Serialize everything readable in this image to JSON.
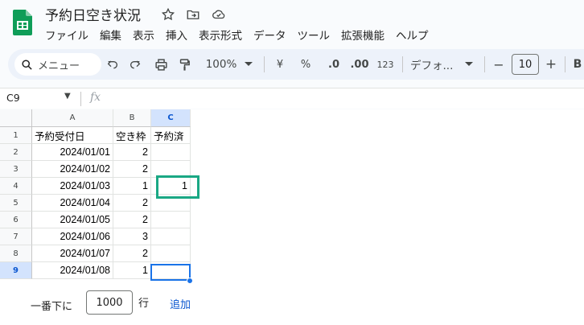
{
  "app": {
    "title": "予約日空き状況",
    "menu": [
      "ファイル",
      "編集",
      "表示",
      "挿入",
      "表示形式",
      "データ",
      "ツール",
      "拡張機能",
      "ヘルプ"
    ]
  },
  "toolbar": {
    "search_label": "メニュー",
    "zoom": "100%",
    "currency": "¥",
    "percent": "%",
    "decrease_decimal": ".0",
    "increase_decimal": ".00",
    "number_format": "123",
    "font": "デフォ...",
    "font_size": "10",
    "minus": "−",
    "plus": "+",
    "bold": "B"
  },
  "formula_bar": {
    "name_box": "C9",
    "fx": "fx"
  },
  "sheet": {
    "columns": [
      "A",
      "B",
      "C"
    ],
    "rows": [
      "1",
      "2",
      "3",
      "4",
      "5",
      "6",
      "7",
      "8",
      "9"
    ],
    "cells": [
      [
        "予約受付日",
        "空き枠",
        "予約済"
      ],
      [
        "2024/01/01",
        "2",
        ""
      ],
      [
        "2024/01/02",
        "2",
        ""
      ],
      [
        "2024/01/03",
        "1",
        "1"
      ],
      [
        "2024/01/04",
        "2",
        ""
      ],
      [
        "2024/01/05",
        "2",
        ""
      ],
      [
        "2024/01/06",
        "3",
        ""
      ],
      [
        "2024/01/07",
        "2",
        ""
      ],
      [
        "2024/01/08",
        "1",
        ""
      ]
    ],
    "selected_cell": "C9"
  },
  "add_rows": {
    "label": "一番下に",
    "count": "1000",
    "unit": "行",
    "button": "追加"
  },
  "colors": {
    "highlight": "#1aa884",
    "selection": "#1a73e8",
    "brand": "#0f9d58"
  }
}
